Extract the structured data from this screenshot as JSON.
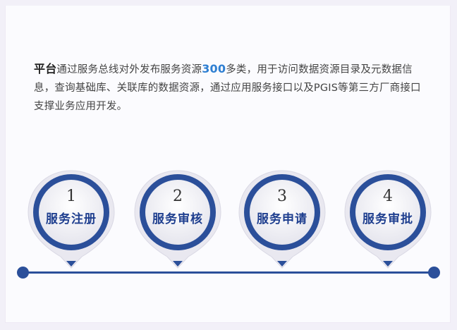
{
  "intro": {
    "lead": "平台",
    "before_num": "通过服务总线对外发布服务资源",
    "num": "300",
    "after_num": "多类，用于访问数据资源目录及元数据信息，查询基础库、关联库的数据资源，通过应用服务接口以及PGIS等第三方厂商接口支撑业务应用开发。"
  },
  "steps": [
    {
      "number": "1",
      "name": "服务注册"
    },
    {
      "number": "2",
      "name": "服务审核"
    },
    {
      "number": "3",
      "name": "服务申请"
    },
    {
      "number": "4",
      "name": "服务审批"
    }
  ],
  "colors": {
    "accent": "#2b4f9a",
    "number_highlight": "#2f7fd2",
    "step_name": "#1f3f8f"
  }
}
